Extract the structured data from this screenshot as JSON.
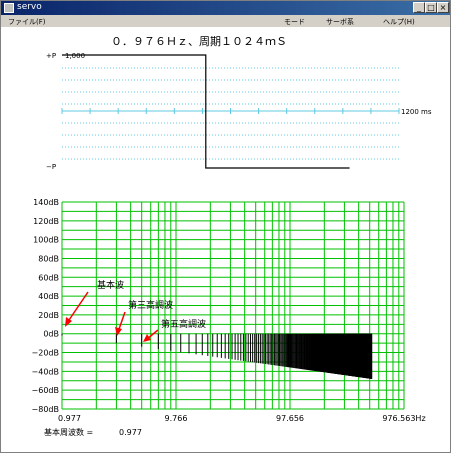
{
  "window": {
    "title": "servo",
    "controls": [
      "_",
      "□",
      "×"
    ]
  },
  "menu": {
    "left": [
      "ファイル(F)"
    ],
    "right": [
      "モード",
      "サーボ系",
      "ヘルプ(H)"
    ]
  },
  "header": {
    "text": "０．９７６Ｈｚ、周期１０２４ｍＳ"
  },
  "waveform": {
    "labels": {
      "plus": "+P",
      "plus_value": "1,000",
      "minus": "−P",
      "time_end": "1200 ms"
    },
    "x_range_ms": [
      0,
      1200
    ],
    "signal": {
      "type": "square",
      "high_from_ms": 0,
      "high_to_ms": 512,
      "low_to_ms": 1024,
      "level_high": 1,
      "level_low": -1
    }
  },
  "spectrum": {
    "y_ticks": [
      "140dB",
      "120dB",
      "100dB",
      "80dB",
      "60dB",
      "40dB",
      "20dB",
      "0dB",
      "−20dB",
      "−40dB",
      "−60dB",
      "−80dB"
    ],
    "x_ticks": [
      "0.977",
      "9.766",
      "97.656",
      "976.563Hz"
    ],
    "annotations": [
      "基本波",
      "第三高調波",
      "第五高調波"
    ],
    "footer": {
      "label": "基本周波数 =",
      "value": "0.977"
    }
  },
  "chart_data": {
    "type": "bar",
    "xscale": "log",
    "xlim": [
      0.977,
      976.563
    ],
    "ylim": [
      -80,
      140
    ],
    "ylabel_unit": "dB",
    "fundamental_hz": 0.977,
    "harmonics": "odd",
    "first_harmonic_db": -2,
    "last_harmonic_db": -48,
    "colors": {
      "grid": "#00c000",
      "bars": "#000000",
      "arrows": "#ff0000",
      "wave": "#000000",
      "dotted": "#5fc8e0"
    }
  }
}
